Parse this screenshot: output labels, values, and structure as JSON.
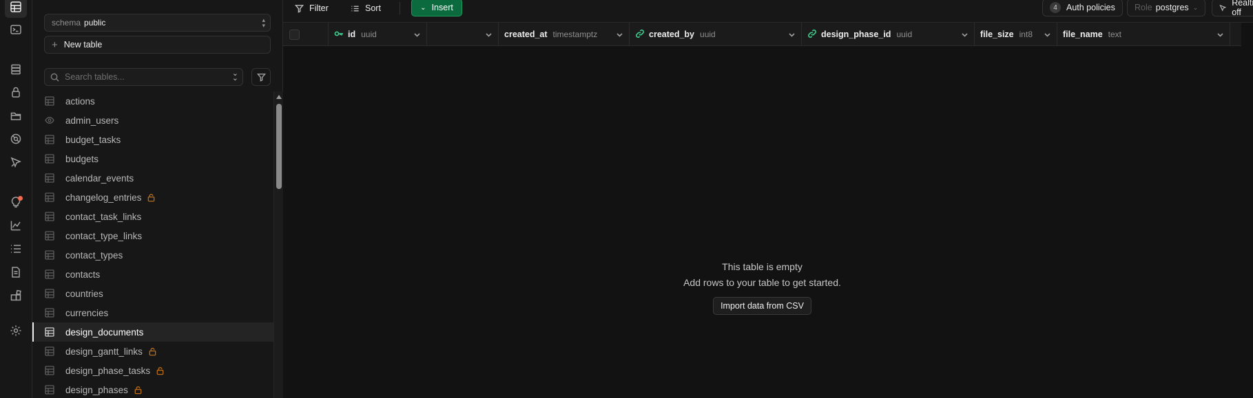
{
  "rail": {
    "icons": [
      "table-editor-icon",
      "sql-editor-icon",
      "database-icon",
      "auth-lock-icon",
      "storage-icon",
      "realtime-icon",
      "edge-functions-icon",
      "advisors-icon",
      "reports-icon",
      "logs-icon",
      "api-docs-icon",
      "integrations-icon",
      "settings-icon"
    ]
  },
  "sidebar": {
    "schema_label": "schema",
    "schema_value": "public",
    "new_table_label": "New table",
    "search_placeholder": "Search tables...",
    "tables": [
      {
        "name": "actions",
        "kind": "table",
        "locked": false,
        "active": false
      },
      {
        "name": "admin_users",
        "kind": "view",
        "locked": false,
        "active": false
      },
      {
        "name": "budget_tasks",
        "kind": "table",
        "locked": false,
        "active": false
      },
      {
        "name": "budgets",
        "kind": "table",
        "locked": false,
        "active": false
      },
      {
        "name": "calendar_events",
        "kind": "table",
        "locked": false,
        "active": false
      },
      {
        "name": "changelog_entries",
        "kind": "table",
        "locked": true,
        "active": false
      },
      {
        "name": "contact_task_links",
        "kind": "table",
        "locked": false,
        "active": false
      },
      {
        "name": "contact_type_links",
        "kind": "table",
        "locked": false,
        "active": false
      },
      {
        "name": "contact_types",
        "kind": "table",
        "locked": false,
        "active": false
      },
      {
        "name": "contacts",
        "kind": "table",
        "locked": false,
        "active": false
      },
      {
        "name": "countries",
        "kind": "table",
        "locked": false,
        "active": false
      },
      {
        "name": "currencies",
        "kind": "table",
        "locked": false,
        "active": false
      },
      {
        "name": "design_documents",
        "kind": "table",
        "locked": false,
        "active": true
      },
      {
        "name": "design_gantt_links",
        "kind": "table",
        "locked": true,
        "active": false
      },
      {
        "name": "design_phase_tasks",
        "kind": "table",
        "locked": true,
        "active": false
      },
      {
        "name": "design_phases",
        "kind": "table",
        "locked": true,
        "active": false
      }
    ]
  },
  "toolbar": {
    "filter_label": "Filter",
    "sort_label": "Sort",
    "insert_label": "Insert",
    "auth_policies_count": "4",
    "auth_policies_label": "Auth policies",
    "role_label": "Role",
    "role_value": "postgres",
    "realtime_label": "Realtime off"
  },
  "columns": [
    {
      "name": "id",
      "type": "uuid",
      "icon": "key"
    },
    {
      "name": "",
      "type": "",
      "icon": "none"
    },
    {
      "name": "created_at",
      "type": "timestamptz",
      "icon": "none"
    },
    {
      "name": "created_by",
      "type": "uuid",
      "icon": "link"
    },
    {
      "name": "design_phase_id",
      "type": "uuid",
      "icon": "link"
    },
    {
      "name": "file_size",
      "type": "int8",
      "icon": "none"
    },
    {
      "name": "file_name",
      "type": "text",
      "icon": "none"
    }
  ],
  "empty_state": {
    "title": "This table is empty",
    "subtitle": "Add rows to your table to get started.",
    "import_label": "Import data from CSV"
  },
  "colors": {
    "accent": "#3ecf8e",
    "insert_bg": "#0c6b3e",
    "lock": "#b96c1a",
    "notification": "#f26b4f"
  }
}
